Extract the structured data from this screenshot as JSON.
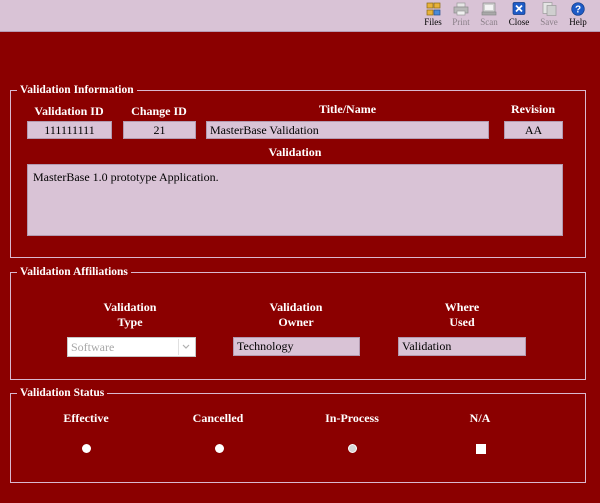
{
  "toolbar": {
    "files": "Files",
    "print": "Print",
    "scan": "Scan",
    "close": "Close",
    "save": "Save",
    "help": "Help"
  },
  "info": {
    "legend": "Validation Information",
    "validation_id_label": "Validation ID",
    "validation_id_value": "111111111",
    "change_id_label": "Change ID",
    "change_id_value": "21",
    "title_label": "Title/Name",
    "title_value": "MasterBase Validation",
    "revision_label": "Revision",
    "revision_value": "AA",
    "validation_label": "Validation",
    "validation_text": "MasterBase 1.0 prototype Application."
  },
  "affiliations": {
    "legend": "Validation Affiliations",
    "type_label_1": "Validation",
    "type_label_2": "Type",
    "type_value": "Software",
    "owner_label_1": "Validation",
    "owner_label_2": "Owner",
    "owner_value": "Technology",
    "where_label_1": "Where",
    "where_label_2": "Used",
    "where_value": "Validation"
  },
  "status": {
    "legend": "Validation Status",
    "effective": "Effective",
    "cancelled": "Cancelled",
    "in_process": "In-Process",
    "na": "N/A"
  }
}
